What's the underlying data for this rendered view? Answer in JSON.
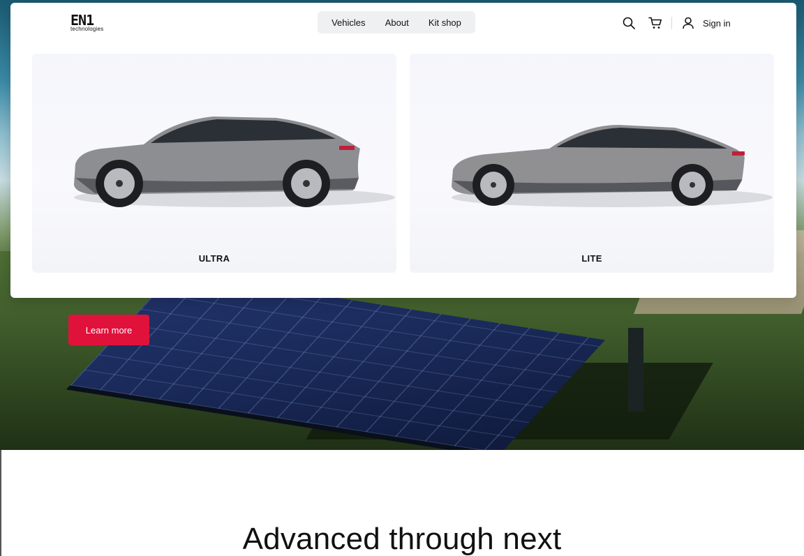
{
  "header": {
    "logo_glyphs": "EN1",
    "logo_sub": "technologies",
    "nav": [
      {
        "label": "Vehicles"
      },
      {
        "label": "About"
      },
      {
        "label": "Kit shop"
      }
    ],
    "signin_label": "Sign in",
    "icons": [
      "search-icon",
      "cart-icon",
      "user-icon"
    ]
  },
  "vehicles": [
    {
      "label": "ULTRA"
    },
    {
      "label": "LITE"
    }
  ],
  "hero": {
    "cta_label": "Learn more",
    "cta_color": "#e0123c"
  },
  "section": {
    "headline": "Advanced through next"
  }
}
